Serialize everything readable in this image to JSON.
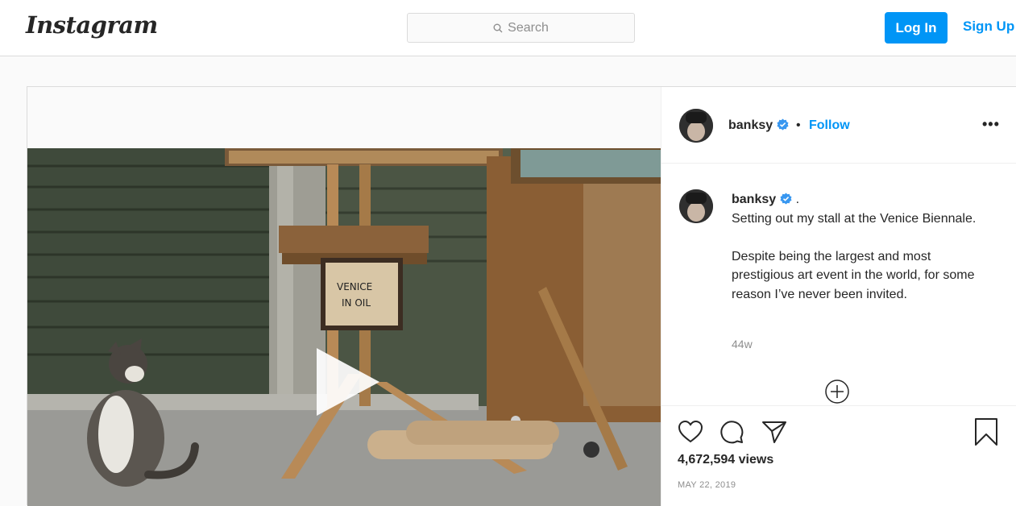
{
  "header": {
    "logo": "Instagram",
    "search_placeholder": "Search",
    "login_label": "Log In",
    "signup_label": "Sign Up"
  },
  "post": {
    "username": "banksy",
    "separator": "•",
    "follow_label": "Follow",
    "more_label": "•••",
    "caption_suffix": ".",
    "caption_lines": [
      "Setting out my stall at the Venice Biennale.",
      "Despite being the largest and most prestigious art event in the world, for some reason I’ve never been invited."
    ],
    "time_ago": "44w",
    "views": "4,672,594 views",
    "date": "MAY 22, 2019",
    "sign_text": "VENICE IN OIL"
  },
  "colors": {
    "accent": "#0095f6",
    "verified": "#3897f0",
    "border": "#dbdbdb",
    "muted": "#8e8e8e"
  },
  "icons": [
    "search-icon",
    "verified-icon",
    "more-icon",
    "play-icon",
    "add-comment-icon",
    "heart-icon",
    "comment-icon",
    "share-icon",
    "bookmark-icon"
  ]
}
